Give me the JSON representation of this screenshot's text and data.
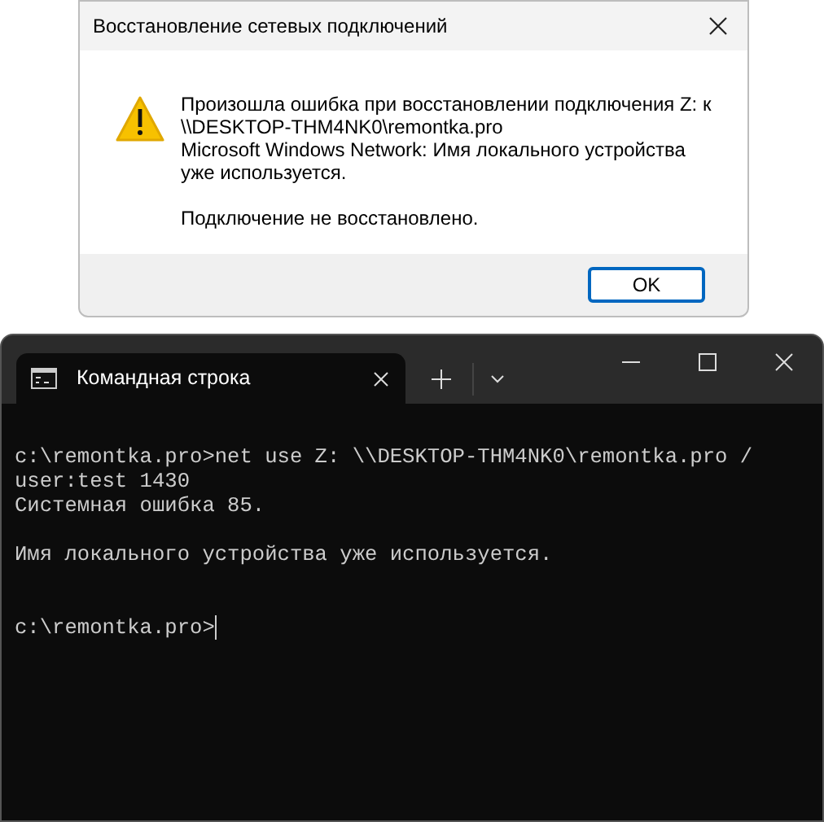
{
  "dialog": {
    "title": "Восстановление сетевых подключений",
    "message_lines": [
      "Произошла ошибка при восстановлении подключения Z: к",
      "\\\\DESKTOP-THM4NK0\\remontka.pro",
      "Microsoft Windows Network: Имя локального устройства",
      "уже используется."
    ],
    "status": "Подключение не восстановлено.",
    "button": "OK"
  },
  "terminal": {
    "tabs": [
      {
        "label": "Командная строка",
        "selected": true
      }
    ],
    "lines": [
      {
        "kind": "text",
        "text": "c:\\remontka.pro>net use Z: \\\\DESKTOP-THM4NK0\\remontka.pro /"
      },
      {
        "kind": "text",
        "text": "user:test 1430"
      },
      {
        "kind": "text",
        "text": "Системная ошибка 85."
      },
      {
        "kind": "blank"
      },
      {
        "kind": "text",
        "text": "Имя локального устройства уже используется."
      },
      {
        "kind": "blank"
      },
      {
        "kind": "blank"
      },
      {
        "kind": "prompt",
        "text": "c:\\remontka.pro>"
      }
    ]
  }
}
